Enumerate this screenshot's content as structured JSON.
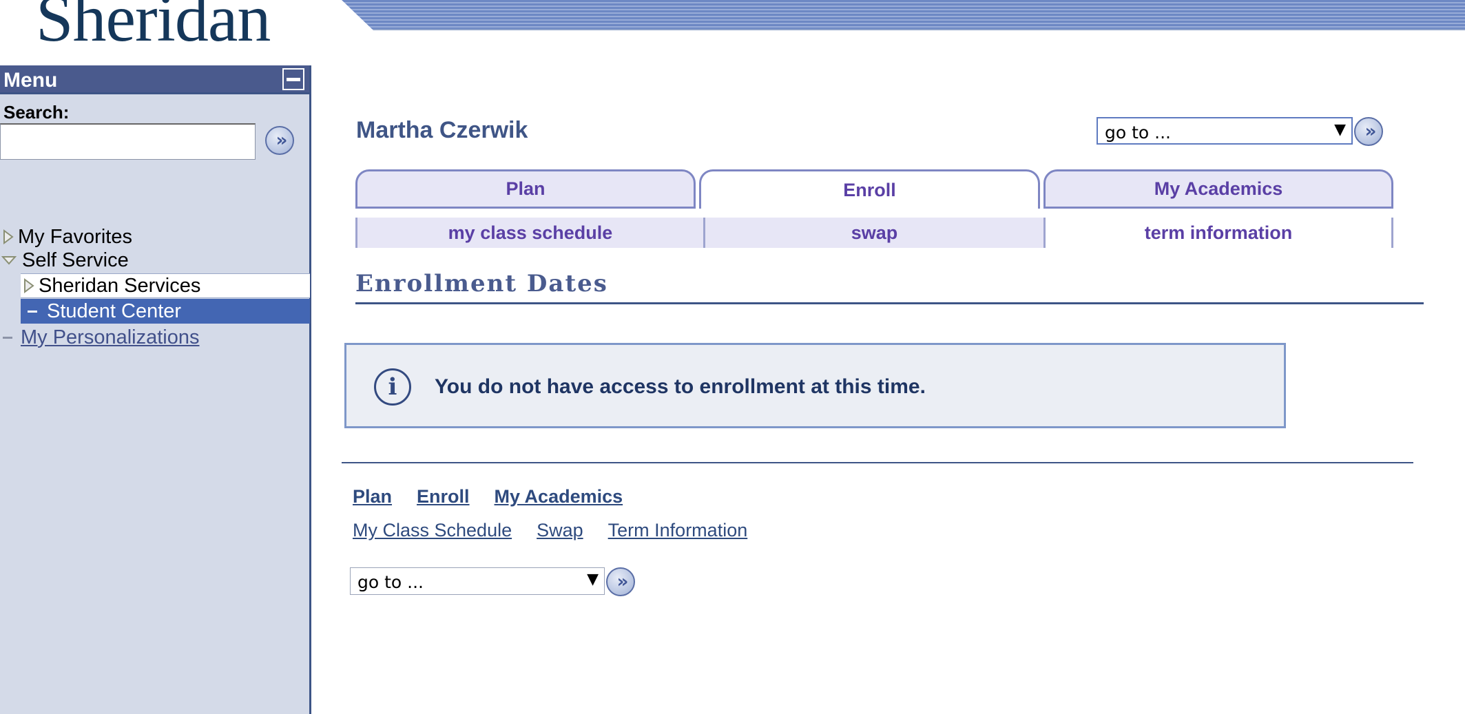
{
  "header": {
    "logo_text": "Sheridan"
  },
  "sidebar": {
    "menu_title": "Menu",
    "search_label": "Search:",
    "search_value": "",
    "items": [
      {
        "label": "My Favorites"
      },
      {
        "label": "Self Service"
      },
      {
        "label": "Sheridan Services"
      },
      {
        "label": "Student Center"
      },
      {
        "label": "My Personalizations"
      }
    ]
  },
  "main": {
    "user_name": "Martha Czerwik",
    "goto_label": "go to ...",
    "tabs": [
      {
        "label": "Plan"
      },
      {
        "label": "Enroll"
      },
      {
        "label": "My Academics"
      }
    ],
    "subtabs": [
      {
        "label": "my class schedule"
      },
      {
        "label": "swap"
      },
      {
        "label": "term information"
      }
    ],
    "heading": "Enrollment Dates",
    "alert_message": "You do not have access to enrollment at this time.",
    "bottom_links": [
      {
        "label": "Plan"
      },
      {
        "label": "Enroll"
      },
      {
        "label": "My Academics"
      }
    ],
    "bottom_sublinks": [
      {
        "label": "My Class Schedule"
      },
      {
        "label": "Swap"
      },
      {
        "label": "Term Information"
      }
    ],
    "goto_label_bottom": "go to ..."
  },
  "colors": {
    "menu_header": "#4a5a8d",
    "sidebar_bg": "#d4dae8",
    "tab_text": "#5a3fa5",
    "selected_item": "#4366b3"
  }
}
